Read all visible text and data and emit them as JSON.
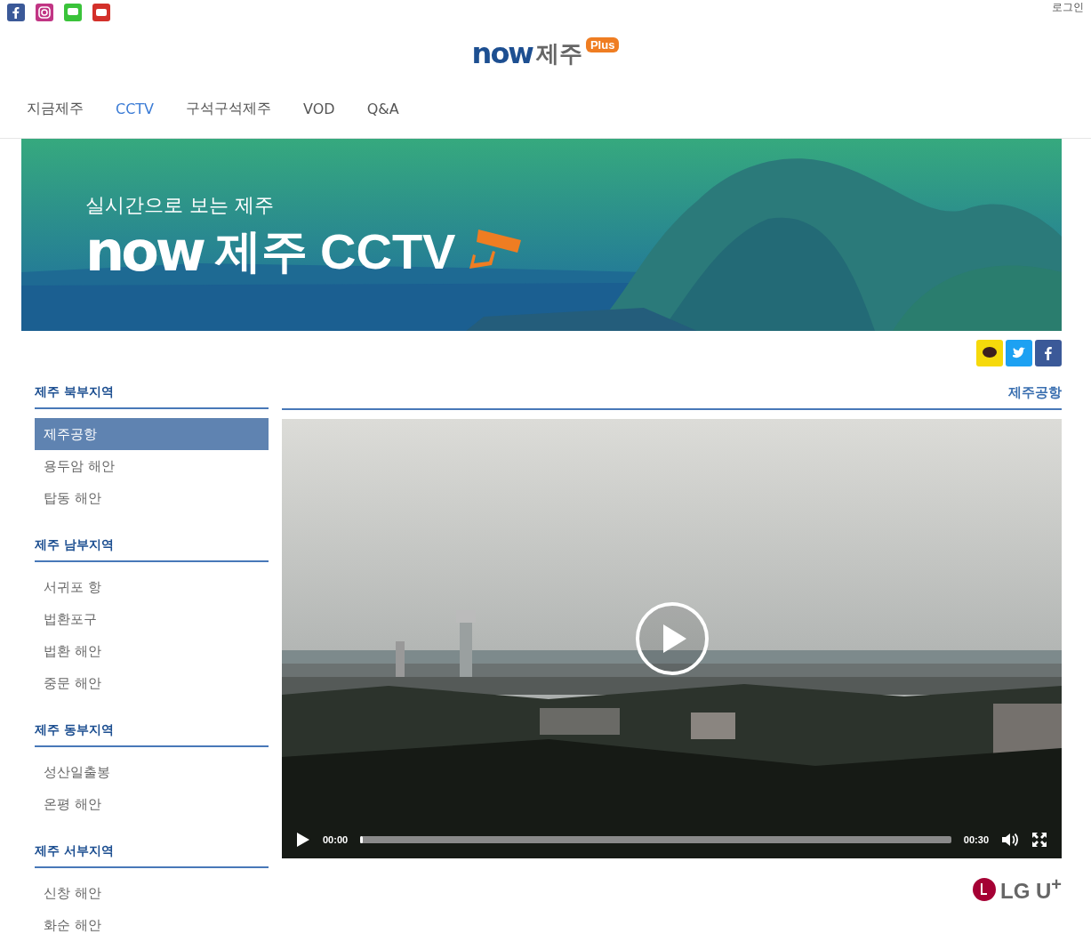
{
  "top_bar": {
    "login": "로그인"
  },
  "logo": {
    "word": "now",
    "region": "제주",
    "badge": "Plus"
  },
  "nav": [
    {
      "label": "지금제주",
      "selected": false
    },
    {
      "label": "CCTV",
      "selected": true
    },
    {
      "label": "구석구석제주",
      "selected": false
    },
    {
      "label": "VOD",
      "selected": false
    },
    {
      "label": "Q&A",
      "selected": false
    }
  ],
  "banner": {
    "subtitle": "실시간으로 보는 제주",
    "word": "now",
    "region": "제주",
    "title": "CCTV"
  },
  "sidebar": [
    {
      "heading": "제주 북부지역",
      "items": [
        {
          "label": "제주공항",
          "selected": true
        },
        {
          "label": "용두암 해안",
          "selected": false
        },
        {
          "label": "탑동 해안",
          "selected": false
        }
      ]
    },
    {
      "heading": "제주 남부지역",
      "items": [
        {
          "label": "서귀포 항",
          "selected": false
        },
        {
          "label": "법환포구",
          "selected": false
        },
        {
          "label": "법환 해안",
          "selected": false
        },
        {
          "label": "중문 해안",
          "selected": false
        }
      ]
    },
    {
      "heading": "제주 동부지역",
      "items": [
        {
          "label": "성산일출봉",
          "selected": false
        },
        {
          "label": "온평 해안",
          "selected": false
        }
      ]
    },
    {
      "heading": "제주 서부지역",
      "items": [
        {
          "label": "신창 해안",
          "selected": false
        },
        {
          "label": "화순 해안",
          "selected": false
        }
      ]
    }
  ],
  "content": {
    "title": "제주공항",
    "player": {
      "current": "00:00",
      "duration": "00:30",
      "level": 0
    }
  },
  "sponsor": "LG U$^{+}$"
}
